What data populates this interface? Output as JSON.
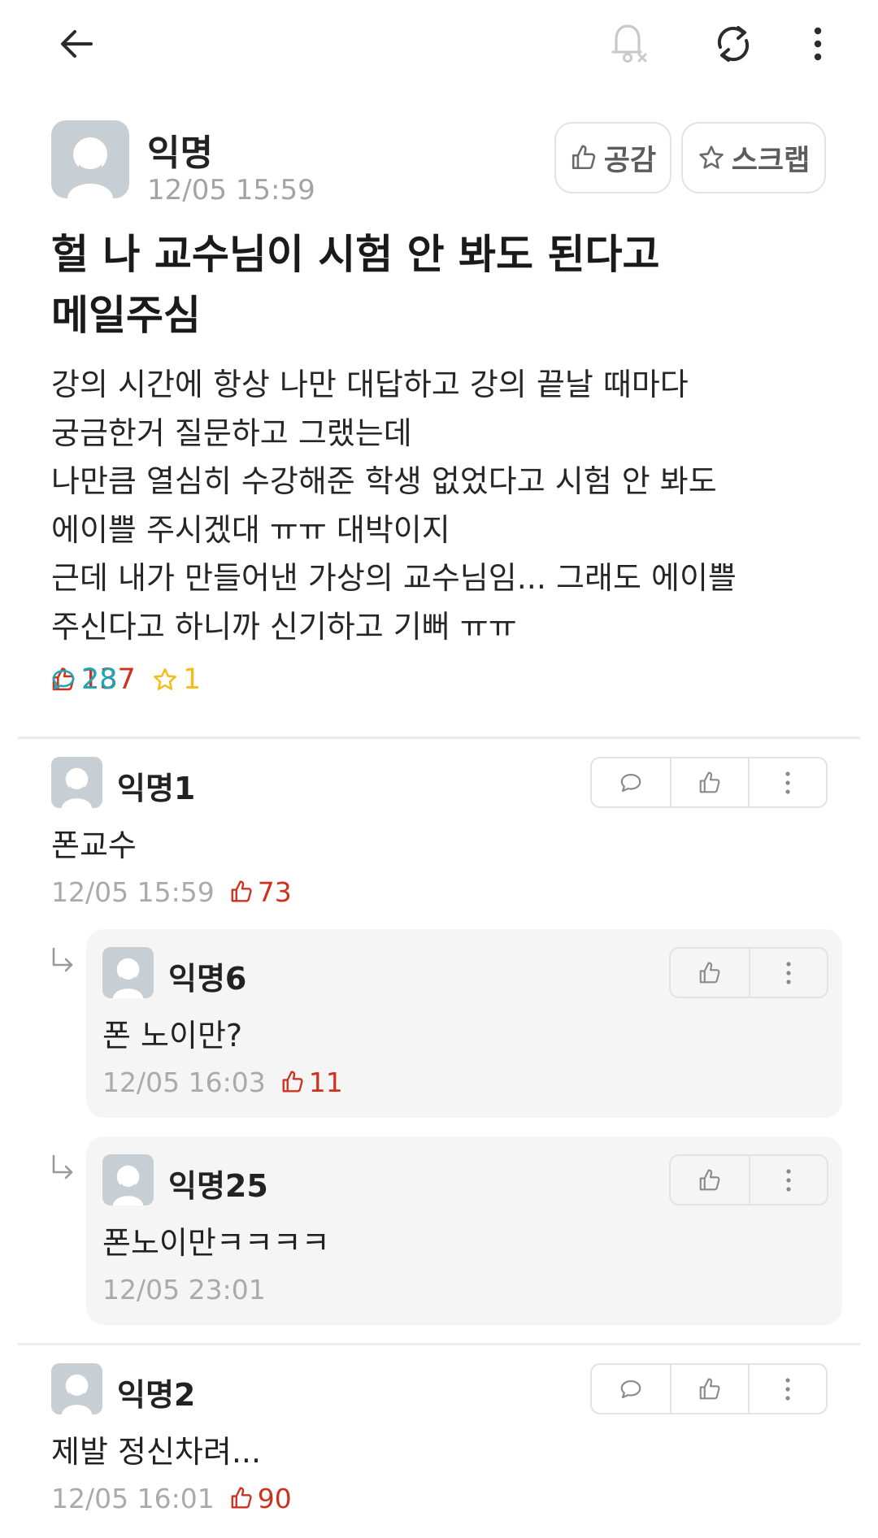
{
  "header": {
    "back_icon": "arrow-left-icon",
    "notification_icon": "bell-off-icon",
    "refresh_icon": "refresh-icon",
    "more_icon": "more-vertical-icon"
  },
  "post": {
    "author": "익명",
    "time": "12/05 15:59",
    "like_button_label": "공감",
    "scrap_button_label": "스크랩",
    "title_lines": [
      "헐 나 교수님이 시험 안 봐도 된다고",
      "메일주심"
    ],
    "body_lines": [
      "강의 시간에 항상 나만 대답하고 강의 끝날 때마다",
      "궁금한거 질문하고 그랬는데",
      "나만큼 열심히 수강해준 학생 없었다고 시험 안 봐도",
      "에이쁠 주시겠대 ㅠㅠ 대박이지",
      "근데 내가 만들어낸 가상의 교수님임... 그래도 에이쁠",
      "주신다고 하니까 신기하고 기뻐 ㅠㅠ"
    ],
    "stats": {
      "likes": "137",
      "comments": "28",
      "scraps": "1"
    }
  },
  "comments": [
    {
      "author": "익명1",
      "body": "폰교수",
      "time": "12/05 15:59",
      "likes": "73"
    },
    {
      "author": "익명2",
      "body": "제발 정신차려...",
      "time": "12/05 16:01",
      "likes": "90"
    }
  ],
  "replies": [
    {
      "author": "익명6",
      "body": "폰 노이만?",
      "time": "12/05 16:03",
      "likes": "11"
    },
    {
      "author": "익명25",
      "body": "폰노이만ㅋㅋㅋㅋ",
      "time": "12/05 23:01",
      "likes": ""
    }
  ],
  "colors": {
    "like": "#d0301e",
    "comment": "#1ba7b4",
    "scrap": "#f3bd1b",
    "meta_gray": "#aaaaaa",
    "reply_bg": "#f5f5f5"
  }
}
